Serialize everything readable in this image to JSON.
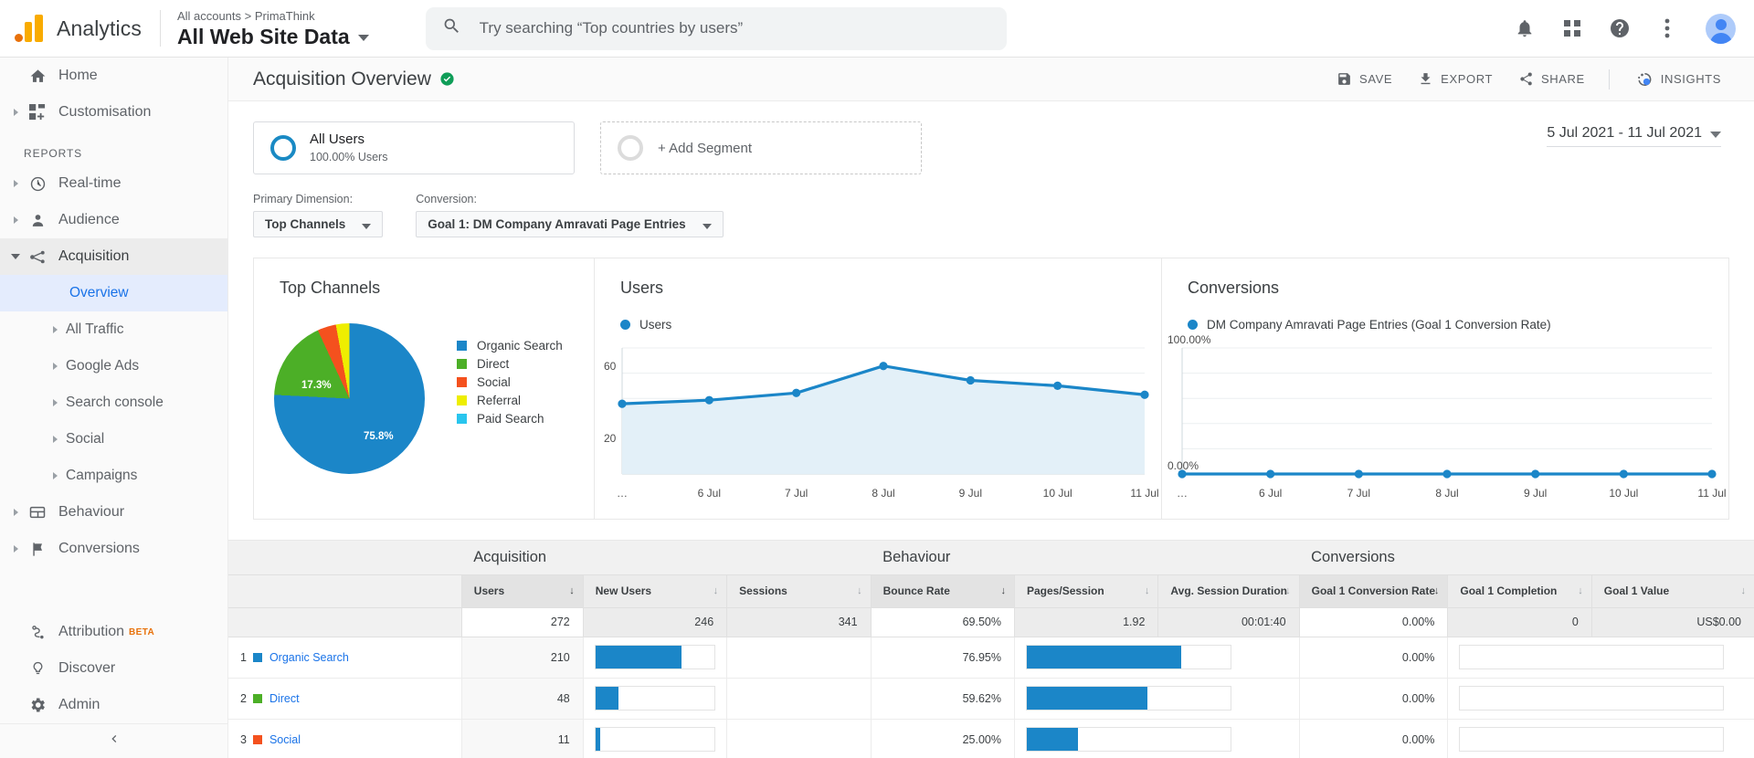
{
  "topbar": {
    "brand": "Analytics",
    "breadcrumb": "All accounts > PrimaThink",
    "view_name": "All Web Site Data",
    "search_placeholder": "Try searching “Top countries by users”",
    "icons": [
      "bell-icon",
      "apps-grid-icon",
      "help-icon",
      "more-vert-icon",
      "avatar"
    ]
  },
  "sidebar": {
    "primary": [
      {
        "label": "Home",
        "icon": "home-icon",
        "expandable": false
      },
      {
        "label": "Customisation",
        "icon": "customisation-icon",
        "expandable": true
      }
    ],
    "section_label": "REPORTS",
    "reports": [
      {
        "label": "Real-time",
        "icon": "clock-icon",
        "expandable": true,
        "active": false
      },
      {
        "label": "Audience",
        "icon": "person-icon",
        "expandable": true,
        "active": false
      },
      {
        "label": "Acquisition",
        "icon": "acquisition-icon",
        "expandable": true,
        "active": true
      },
      {
        "label": "Behaviour",
        "icon": "behaviour-icon",
        "expandable": true,
        "active": false
      },
      {
        "label": "Conversions",
        "icon": "flag-icon",
        "expandable": true,
        "active": false
      }
    ],
    "acquisition_children": [
      {
        "label": "Overview",
        "selected": true
      },
      {
        "label": "All Traffic",
        "selected": false
      },
      {
        "label": "Google Ads",
        "selected": false
      },
      {
        "label": "Search console",
        "selected": false
      },
      {
        "label": "Social",
        "selected": false
      },
      {
        "label": "Campaigns",
        "selected": false
      }
    ],
    "bottom": [
      {
        "label": "Attribution",
        "icon": "attribution-icon",
        "badge": "BETA"
      },
      {
        "label": "Discover",
        "icon": "bulb-icon",
        "badge": ""
      },
      {
        "label": "Admin",
        "icon": "gear-icon",
        "badge": ""
      }
    ],
    "collapse_icon": "chevron-left-icon"
  },
  "page": {
    "title": "Acquisition Overview",
    "verified_icon": "verified-check-icon",
    "actions": [
      {
        "label": "SAVE",
        "icon": "save-icon"
      },
      {
        "label": "EXPORT",
        "icon": "export-icon"
      },
      {
        "label": "SHARE",
        "icon": "share-icon"
      },
      {
        "label": "INSIGHTS",
        "icon": "insights-icon"
      }
    ]
  },
  "segments": {
    "all_users": {
      "title": "All Users",
      "subtitle": "100.00% Users"
    },
    "add_segment_label": "+ Add Segment"
  },
  "date_range": "5 Jul 2021 - 11 Jul 2021",
  "controls": {
    "primary_dimension_label": "Primary Dimension:",
    "primary_dimension_value": "Top Channels",
    "conversion_label": "Conversion:",
    "conversion_value": "Goal 1: DM Company Amravati Page Entries"
  },
  "cards": {
    "top_channels_title": "Top Channels",
    "users_title": "Users",
    "conversions_title": "Conversions"
  },
  "chart_data": [
    {
      "type": "pie",
      "title": "Top Channels",
      "legend_position": "right",
      "labels": [
        "Organic Search",
        "Direct",
        "Social",
        "Referral",
        "Paid Search"
      ],
      "values": [
        75.8,
        17.3,
        4.0,
        2.9,
        0.0
      ],
      "colors": [
        "#1b86c8",
        "#4caf27",
        "#f4511e",
        "#eeee00",
        "#29c5ee"
      ],
      "visible_slice_labels": [
        {
          "text": "75.8%",
          "x": 98,
          "y": 118
        },
        {
          "text": "17.3%",
          "x": 30,
          "y": 62
        }
      ]
    },
    {
      "type": "area",
      "title": "Users",
      "legend": [
        "Users"
      ],
      "x": [
        "",
        "6 Jul",
        "7 Jul",
        "8 Jul",
        "9 Jul",
        "10 Jul",
        "11 Jul"
      ],
      "series": [
        {
          "name": "Users",
          "values": [
            39,
            41,
            45,
            60,
            52,
            49,
            44
          ]
        }
      ],
      "ylim": [
        0,
        70
      ],
      "yticks": [
        "60",
        "20"
      ],
      "ytick_values": [
        60,
        20
      ],
      "color": "#1b86c8",
      "grid": true
    },
    {
      "type": "line",
      "title": "Conversions",
      "legend": [
        "DM Company Amravati Page Entries (Goal 1 Conversion Rate)"
      ],
      "x": [
        "",
        "6 Jul",
        "7 Jul",
        "8 Jul",
        "9 Jul",
        "10 Jul",
        "11 Jul"
      ],
      "series": [
        {
          "name": "DM Company Amravati Page Entries (Goal 1 Conversion Rate)",
          "values": [
            0,
            0,
            0,
            0,
            0,
            0,
            0
          ]
        }
      ],
      "ylim": [
        0,
        100
      ],
      "yticks": [
        "100.00%",
        "0.00%"
      ],
      "ytick_values": [
        100,
        0
      ],
      "color": "#1b86c8",
      "grid": true
    }
  ],
  "table": {
    "groups": [
      {
        "label": "Acquisition",
        "span": 3
      },
      {
        "label": "Behaviour",
        "span": 3
      },
      {
        "label": "Conversions",
        "span": 3
      }
    ],
    "columns": [
      {
        "label": "Users",
        "sorted": true
      },
      {
        "label": "New Users",
        "sorted": false
      },
      {
        "label": "Sessions",
        "sorted": false
      },
      {
        "label": "Bounce Rate",
        "sorted": false
      },
      {
        "label": "Pages/Session",
        "sorted": false
      },
      {
        "label": "Avg. Session Duration",
        "sorted": false
      },
      {
        "label": "Goal 1 Conversion Rate",
        "sorted": false
      },
      {
        "label": "Goal 1 Completion",
        "sorted": false
      },
      {
        "label": "Goal 1 Value",
        "sorted": false
      }
    ],
    "totals": [
      "272",
      "246",
      "341",
      "69.50%",
      "1.92",
      "00:01:40",
      "0.00%",
      "0",
      "US$0.00"
    ],
    "rows": [
      {
        "rank": "1",
        "channel": "Organic Search",
        "swatch": "#1b86c8",
        "users": "210",
        "users_pct": 77,
        "new_users_bar": 72,
        "bounce_rate": "76.95%",
        "bounce_bar": 76,
        "goal_rate": "0.00%",
        "goal_bar": 0
      },
      {
        "rank": "2",
        "channel": "Direct",
        "swatch": "#4caf27",
        "users": "48",
        "users_pct": 18,
        "new_users_bar": 19,
        "bounce_rate": "59.62%",
        "bounce_bar": 59,
        "goal_rate": "0.00%",
        "goal_bar": 0
      },
      {
        "rank": "3",
        "channel": "Social",
        "swatch": "#f4511e",
        "users": "11",
        "users_pct": 4,
        "new_users_bar": 4,
        "bounce_rate": "25.00%",
        "bounce_bar": 25,
        "goal_rate": "0.00%",
        "goal_bar": 0
      }
    ]
  },
  "colors": {
    "brand_orange": "#f9ab00",
    "link_blue": "#1a73e8",
    "chart_blue": "#1b86c8",
    "selected_bg": "#e4ecfd",
    "verified_green": "#0f9d58"
  }
}
